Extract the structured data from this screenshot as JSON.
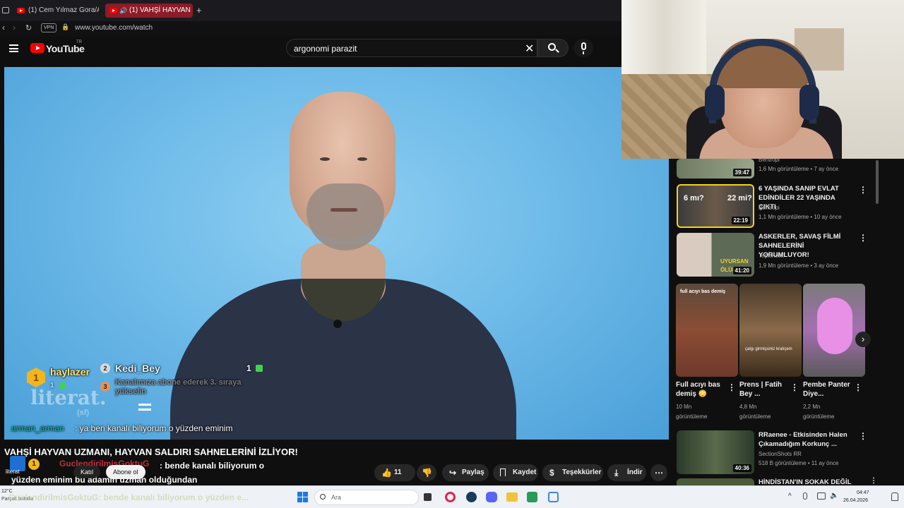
{
  "browser": {
    "tabs": [
      {
        "title": "(1) Cem Yılmaz Gora/Arog"
      },
      {
        "title": "(1) VAHŞİ HAYVAN UZ"
      }
    ],
    "vpn_label": "VPN",
    "url": "www.youtube.com/watch"
  },
  "youtube": {
    "logo_text": "YouTube",
    "region": "TR",
    "search_value": "argonomi parazit"
  },
  "overlay": {
    "rank1_name": "haylazer",
    "rank1_badge": "1",
    "rank1_count": "1",
    "rank2_badge": "2",
    "rank2_name": "Kedi_Bey",
    "rank2_count": "1",
    "rank3_badge": "3",
    "rank3_text": "Kanalımıza abone ederek 3. sıraya yükselin",
    "brand_text": "literat.",
    "brand_sub": "(sf)",
    "chat_user": "arman_arman",
    "chat_message": ": ya ben kanalı biliyorum o yüzden eminim"
  },
  "video": {
    "title": "VAHŞİ HAYVAN UZMANI, HAYVAN SALDIRI SAHNELERİNİ İZLİYOR!",
    "chat_user2": "GuclendirilmisGoktuG",
    "chat_message2": ": bende kanalı biliyorum o yüzden eminim bu adamın uzman olduğundan",
    "channel_short": "literat",
    "join_label": "Katıl",
    "subscribe_label": "Abone ol"
  },
  "actions": {
    "likes": "11 B",
    "share": "Paylaş",
    "save": "Kaydet",
    "thanks": "Teşekkürler",
    "download": "İndir"
  },
  "sidebar": {
    "videos": [
      {
        "duration": "39:47",
        "channel": "Bentropi",
        "meta": "1,6 Mn görüntüleme • 7 ay önce"
      },
      {
        "duration": "22:19",
        "title": "6 YAŞINDA SANIP EVLAT EDİNDİLER 22 YAŞINDA ÇIKTI",
        "channel": "Bentropi",
        "meta": "1,1 Mn görüntüleme • 10 ay önce",
        "thumb_text1": "6 mı?",
        "thumb_text2": "22 mi?"
      },
      {
        "duration": "41:20",
        "title": "ASKERLER, SAVAŞ FİLMİ SAHNELERİNİ YORUMLUYOR!",
        "channel": "TepkiKolik",
        "meta": "1,9 Mn görüntüleme • 3 ay önce",
        "thumb_text1": "UYURSAN",
        "thumb_text2": "ÖLÜR"
      },
      {
        "duration": "40:36",
        "title": "RRaenee - Etkisinden Halen Çıkamadığım Korkunç ...",
        "channel": "SectionShots RR",
        "meta": "518 B görüntüleme • 11 ay önce"
      },
      {
        "title": "HİNDİSTAN'IN SOKAK DEĞİL"
      }
    ],
    "shorts": [
      {
        "title": "Full acıyı bas demiş 😳",
        "views": "10 Mn",
        "views_label": "görüntüleme",
        "thumb_text": "full acıyı bas demiş"
      },
      {
        "title": "Prens | Fatih Bey ...",
        "views": "4,8 Mn",
        "views_label": "görüntüleme",
        "thumb_text": "çalgı girmişsiniz kralıçem"
      },
      {
        "title": "Pembe Panter Diye...",
        "views": "2,2 Mn",
        "views_label": "görüntüleme"
      }
    ]
  },
  "taskbar": {
    "weather": "12°C",
    "weather_desc": "Parçalı bulutlu",
    "search_label": "Ara",
    "time": "04:47",
    "date": "26.04.2026",
    "ticker": "GuclendirilmisGoktuG: bende kanalı biliyorum o yüzden e..."
  },
  "colors": {
    "youtube_red": "#ff0000",
    "chat_user_color": "#1fb6a6",
    "chat_user2_color": "#e0344a",
    "rank_gold": "#f2b51e"
  }
}
